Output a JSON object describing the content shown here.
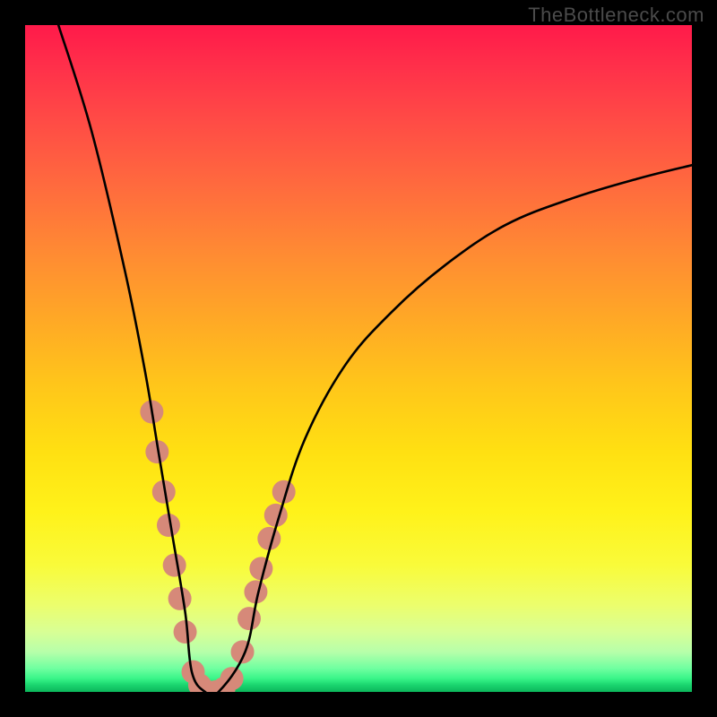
{
  "watermark": "TheBottleneck.com",
  "chart_data": {
    "type": "line",
    "title": "",
    "xlabel": "",
    "ylabel": "",
    "xlim": [
      0,
      100
    ],
    "ylim": [
      0,
      100
    ],
    "grid": false,
    "legend": false,
    "background_gradient": {
      "top": "#ff1a4a",
      "mid": "#ffe012",
      "bottom": "#0cb65a"
    },
    "series": [
      {
        "name": "bottleneck-curve",
        "stroke": "#000000",
        "x": [
          5,
          10,
          15,
          18,
          20,
          22,
          24,
          25,
          27,
          29,
          33,
          35,
          38,
          42,
          48,
          55,
          63,
          72,
          82,
          92,
          100
        ],
        "values": [
          100,
          84,
          63,
          48,
          36,
          24,
          12,
          3,
          0,
          0,
          6,
          15,
          26,
          38,
          49,
          57,
          64,
          70,
          74,
          77,
          79
        ]
      }
    ],
    "markers": {
      "name": "highlight-segment",
      "color": "#d68979",
      "radius_px": 13,
      "points_xy": [
        [
          19.0,
          42
        ],
        [
          19.8,
          36
        ],
        [
          20.8,
          30
        ],
        [
          21.5,
          25
        ],
        [
          22.4,
          19
        ],
        [
          23.2,
          14
        ],
        [
          24.0,
          9
        ],
        [
          25.2,
          3
        ],
        [
          26.2,
          1
        ],
        [
          27.4,
          0
        ],
        [
          28.6,
          0
        ],
        [
          29.8,
          0.5
        ],
        [
          31.0,
          2
        ],
        [
          32.6,
          6
        ],
        [
          33.6,
          11
        ],
        [
          34.6,
          15
        ],
        [
          35.4,
          18.5
        ],
        [
          36.6,
          23
        ],
        [
          37.6,
          26.5
        ],
        [
          38.8,
          30
        ]
      ]
    }
  }
}
